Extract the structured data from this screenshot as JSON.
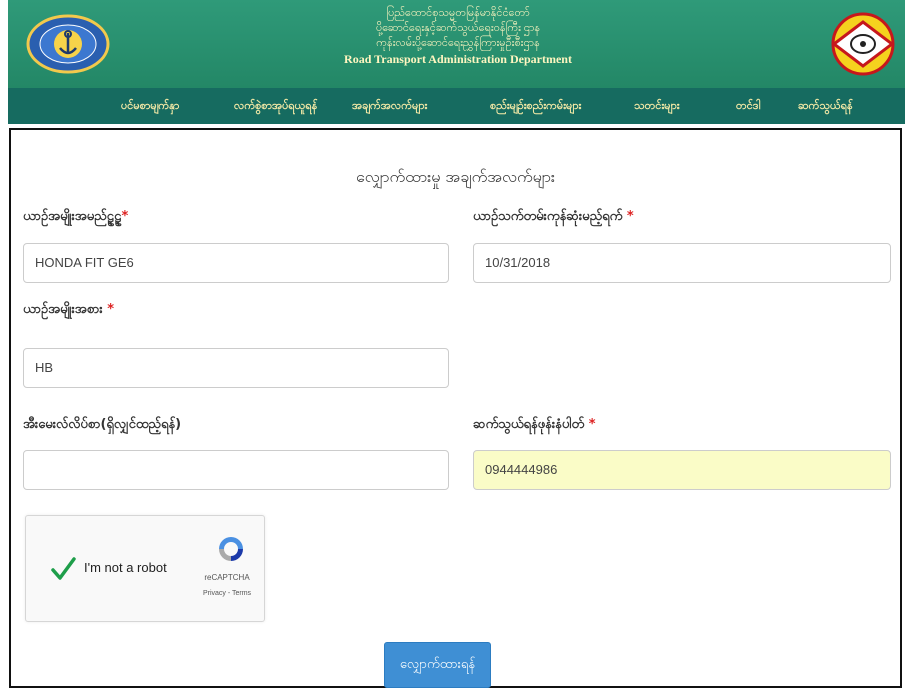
{
  "header": {
    "title_line_1": "ပြည်ထောင်စုသမ္မတမြန်မာနိုင်ငံတော်",
    "title_line_2": "ပို့ဆောင်ရေးနှင့်ဆက်သွယ်ရေးဝန်ကြီး ဌာန",
    "title_line_3": "ကုန်းလမ်းပို့ဆောင်ရေးညွှန်ကြားမှုဦးစီးဌာန",
    "title_english": "Road Transport Administration Department",
    "logo_left_icon": "ministry-seal-icon",
    "logo_right_icon": "rtad-emblem-icon"
  },
  "nav": {
    "items": [
      "ပင်မစာမျက်နှာ",
      "လက်စွဲစာအုပ်ရယူရန်",
      "အချက်အလက်များ",
      "စည်းမျဉ်းစည်းကမ်းများ",
      "သတင်းများ",
      "တင်ဒါ",
      "ဆက်သွယ်ရန်"
    ]
  },
  "form": {
    "title": "လျှောက်ထားမှု အချက်အလက်များ",
    "vehicle_model_label": "ယာဉ်အမျိုးအမည်ဠဠဠဠ",
    "vehicle_model_value": "HONDA FIT GE6",
    "license_expiry_label": "ယာဉ်သက်တမ်းကုန်ဆုံးမည့်ရက်",
    "license_expiry_value": "10/31/2018",
    "vehicle_type_label": "ယာဉ်အမျိုးအစား",
    "vehicle_type_value": "HB",
    "email_label": "အီးမေးလ်လိပ်စာ(ရှိလျှင်ထည့်ရန်)",
    "email_value": "",
    "phone_label": "ဆက်သွယ်ရန်ဖုန်းနံပါတ်",
    "phone_value": "0944444986",
    "required_mark": "*",
    "submit_label": "လျှောက်ထားရန်"
  },
  "captcha": {
    "checkbox_label": "I'm not a robot",
    "brand": "reCAPTCHA",
    "links": "Privacy - Terms",
    "checked": true,
    "check_icon": "checkmark-icon",
    "logo_icon": "recaptcha-logo-icon"
  },
  "colors": {
    "banner": "#2f9a79",
    "nav": "#166b60",
    "nav_text": "#f3e9a6",
    "required": "#d22222",
    "submit": "#3f8fd4",
    "phone_field_bg": "#fafcc7"
  }
}
